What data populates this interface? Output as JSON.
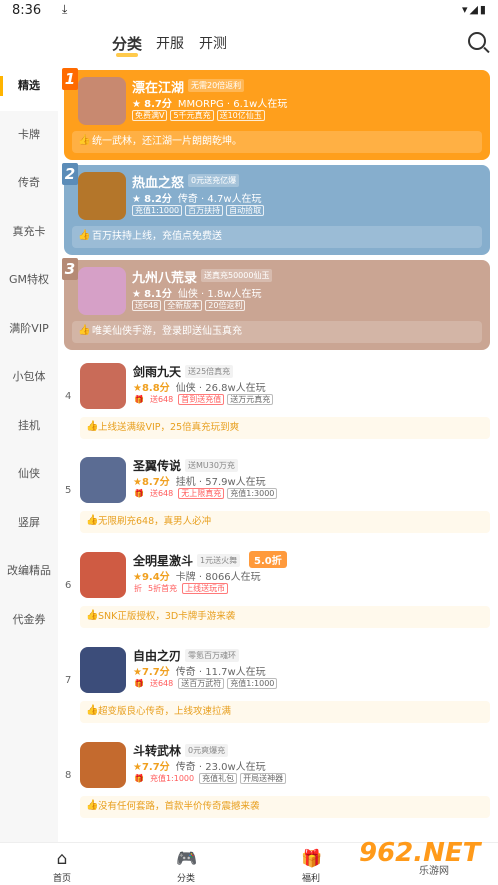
{
  "status": {
    "time": "8:36",
    "download_glyph": "⤓",
    "right_glyphs": "▾◢▮"
  },
  "header": {
    "tabs": [
      "分类",
      "开服",
      "开测"
    ]
  },
  "sidebar": {
    "items": [
      "精选",
      "卡牌",
      "传奇",
      "真充卡",
      "GM特权",
      "满阶VIP",
      "小包体",
      "挂机",
      "仙侠",
      "竖屏",
      "改编精品",
      "代金券"
    ]
  },
  "top_games": [
    {
      "rank": "1",
      "name": "漂在江湖",
      "promo": "无需20倍返利",
      "rating": "8.7分",
      "meta": "MMORPG · 6.1w人在玩",
      "tags": [
        "免费满V",
        "5千元真充",
        "送10亿仙玉"
      ],
      "desc": "统一武林，还江湖一片朗朗乾坤。",
      "color": "#ff9f1c",
      "rank_color": "#ff6a00",
      "thumb": "#c88970"
    },
    {
      "rank": "2",
      "name": "热血之怒",
      "promo": "0元送充亿爆",
      "rating": "8.2分",
      "meta": "传奇 · 4.7w人在玩",
      "tags": [
        "充值1:1000",
        "百万扶持",
        "自动拾取"
      ],
      "desc": "百万扶持上线，充值点免费送",
      "color": "#86aecd",
      "rank_color": "#5b8cb8",
      "thumb": "#b4762a"
    },
    {
      "rank": "3",
      "name": "九州八荒录",
      "promo": "送真充50000仙玉",
      "rating": "8.1分",
      "meta": "仙侠 · 1.8w人在玩",
      "tags": [
        "送648",
        "全新版本",
        "20倍返利"
      ],
      "desc": "唯美仙侠手游，登录即送仙玉真充",
      "color": "#caa593",
      "rank_color": "#b58a75",
      "thumb": "#d6a0c7"
    }
  ],
  "games": [
    {
      "num": "4",
      "name": "剑雨九天",
      "promo": "送25倍真充",
      "badge": "",
      "rating": "8.8分",
      "meta": "仙侠 · 26.8w人在玩",
      "tags": [
        "送648",
        "首到送充值",
        "送万元真充"
      ],
      "desc": "上线送满级VIP，25倍真充玩到爽",
      "thumb": "#c96b58"
    },
    {
      "num": "5",
      "name": "圣翼传说",
      "promo": "送MU30万充",
      "badge": "",
      "rating": "8.7分",
      "meta": "挂机 · 57.9w人在玩",
      "tags": [
        "送648",
        "无上限真充",
        "充值1:3000"
      ],
      "desc": "无限刷充648，真男人必冲",
      "thumb": "#5b6c93"
    },
    {
      "num": "6",
      "name": "全明星激斗",
      "promo": "1元送火舞",
      "badge": "5.0折",
      "rating": "9.4分",
      "meta": "卡牌 · 8066人在玩",
      "tags": [
        "5折首充",
        "上线送玩币"
      ],
      "desc": "SNK正版授权，3D卡牌手游来袭",
      "thumb": "#cf5b43"
    },
    {
      "num": "7",
      "name": "自由之刃",
      "promo": "零氪百万魂环",
      "badge": "",
      "rating": "7.7分",
      "meta": "传奇 · 11.7w人在玩",
      "tags": [
        "送648",
        "送百万武符",
        "充值1:1000"
      ],
      "desc": "超变版良心传奇，上线攻速拉满",
      "thumb": "#3c4d7a"
    },
    {
      "num": "8",
      "name": "斗转武林",
      "promo": "0元爽爆充",
      "badge": "",
      "rating": "7.7分",
      "meta": "传奇 · 23.0w人在玩",
      "tags": [
        "充值1:1000",
        "充值礼包",
        "开局送神器"
      ],
      "desc": "没有任何套路，首款半价传奇震撼来袭",
      "thumb": "#c46a2e"
    }
  ],
  "bottom_nav": [
    {
      "label": "首页",
      "icon": "home-icon",
      "glyph": "⌂"
    },
    {
      "label": "分类",
      "icon": "gamepad-icon",
      "glyph": "🎮"
    },
    {
      "label": "福利",
      "icon": "gift-icon",
      "glyph": "🎁"
    }
  ],
  "watermark": {
    "big": "962.NET",
    "small": "乐游网"
  }
}
